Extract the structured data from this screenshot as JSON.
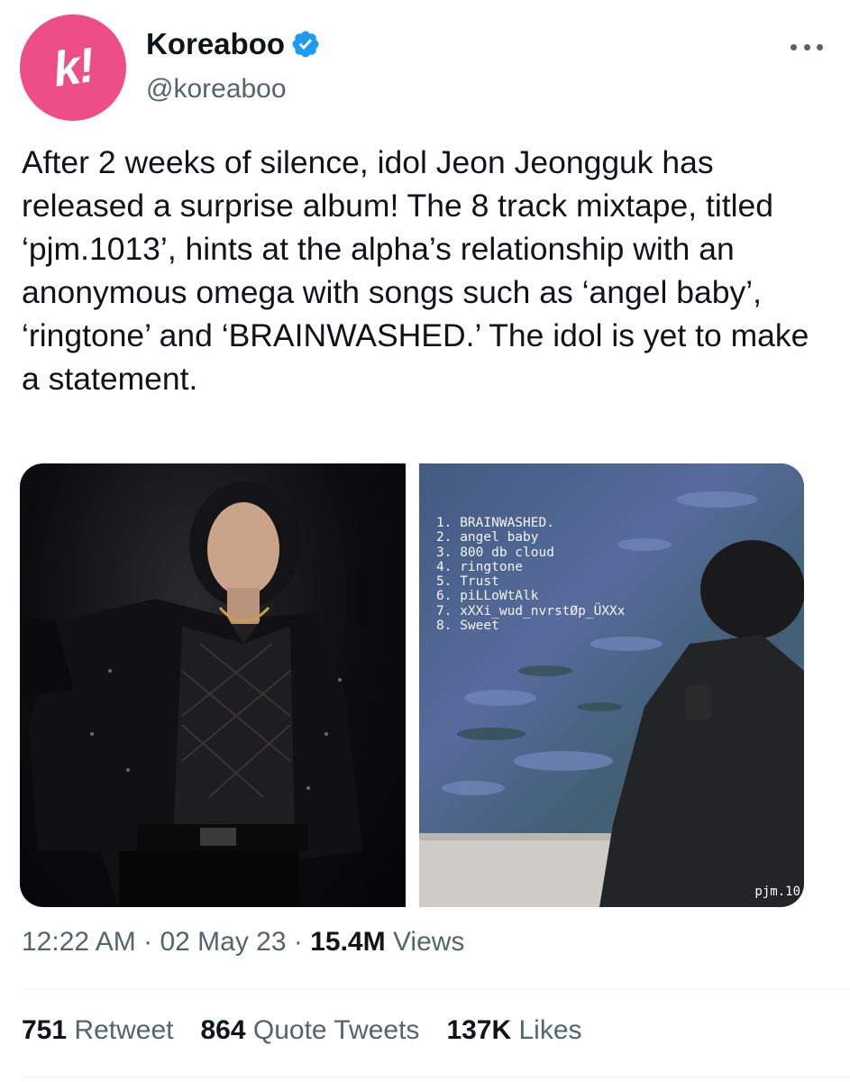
{
  "account": {
    "avatar_glyph": "k!",
    "display_name": "Koreaboo",
    "handle": "@koreaboo",
    "verified_icon": "verified-badge-icon",
    "avatar_color": "#ee4e86",
    "verified_color": "#1d9bf0"
  },
  "menu": {
    "icon": "more-horizontal-icon"
  },
  "tweet": {
    "text": "After 2 weeks of silence, idol Jeon Jeongguk has released a surprise album! The 8 track mixtape, titled ‘pjm.1013’, hints at the alpha’s relationship with an anonymous omega with songs such as ‘angel baby’, ‘ringtone’ and ‘BRAINWASHED.’ The idol is yet to make a statement."
  },
  "media": {
    "tracklist": [
      "1. BRAINWASHED.",
      "2. angel baby",
      "3. 800 db cloud",
      "4. ringtone",
      "5. Trust",
      "6. piLLoWtAlk",
      "7. xXXi_wud_nvrstØp_ÜXXx",
      "8. Sweet"
    ],
    "caption": "pjm.10"
  },
  "meta": {
    "time": "12:22 AM",
    "sep1": " · ",
    "date": "02 May 23",
    "sep2": " · ",
    "views_count": "15.4M",
    "views_label": "Views"
  },
  "stats": {
    "retweets_count": "751",
    "retweets_label": "Retweet",
    "quotes_count": "864",
    "quotes_label": "Quote Tweets",
    "likes_count": "137K",
    "likes_label": "Likes"
  }
}
